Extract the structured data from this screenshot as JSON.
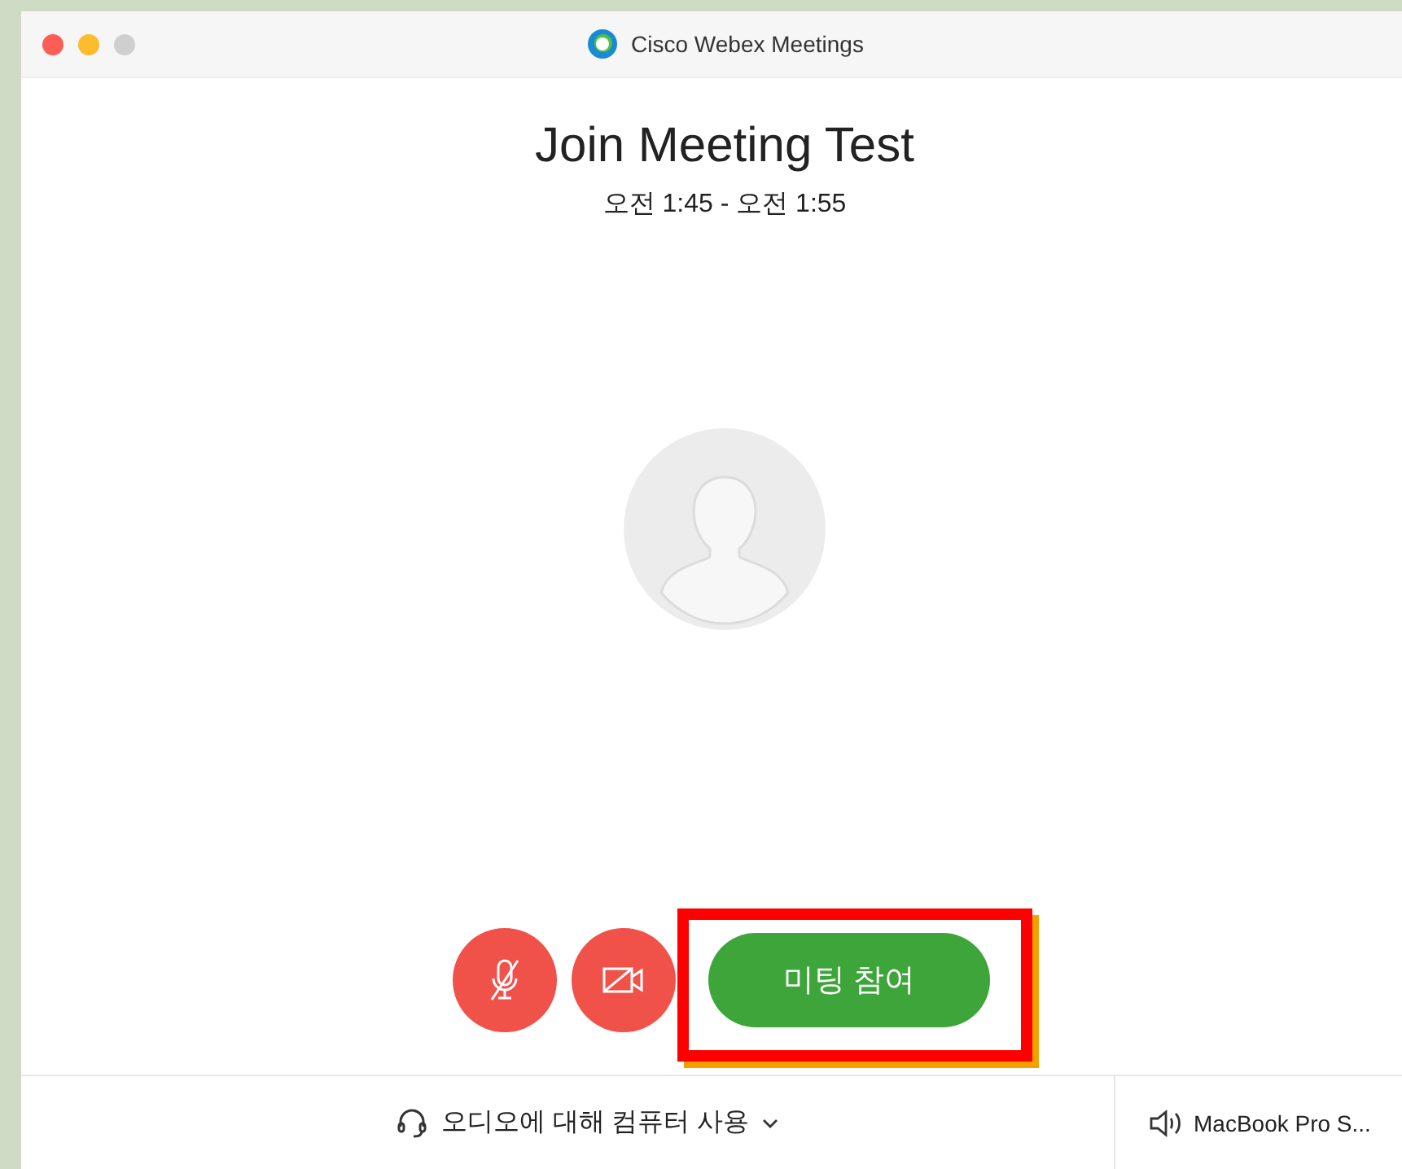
{
  "window": {
    "title": "Cisco Webex Meetings"
  },
  "meeting": {
    "title": "Join Meeting Test",
    "time": "오전 1:45 - 오전 1:55"
  },
  "controls": [
    {
      "kind": "mic",
      "muted": true
    },
    {
      "kind": "camera",
      "muted": true
    }
  ],
  "join_button": {
    "label": "미팅 참여"
  },
  "audio": {
    "label": "오디오에 대해 컴퓨터 사용"
  },
  "speaker": {
    "label": "MacBook Pro S..."
  }
}
